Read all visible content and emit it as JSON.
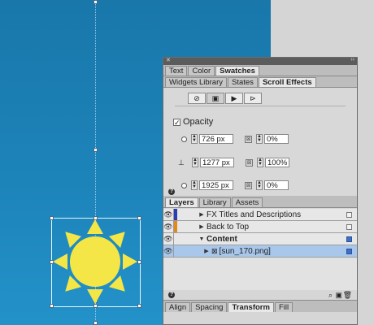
{
  "panel": {
    "top_tabs": [
      "Text",
      "Color",
      "Swatches"
    ],
    "active_top_tab": "Swatches",
    "second_tabs": [
      "Widgets Library",
      "States",
      "Scroll Effects"
    ],
    "active_second_tab": "Scroll Effects",
    "scroll_effects": {
      "mode_icons": [
        "link-icon",
        "image-icon",
        "play-icon",
        "slideshow-icon"
      ],
      "opacity_label": "Opacity",
      "opacity_checked": true,
      "rows": [
        {
          "position": "726 px",
          "opacity": "0%"
        },
        {
          "position": "1277 px",
          "opacity": "100%"
        },
        {
          "position": "1925 px",
          "opacity": "0%"
        }
      ]
    },
    "layer_tabs": [
      "Layers",
      "Library",
      "Assets"
    ],
    "active_layer_tab": "Layers",
    "layers": [
      {
        "name": "FX Titles and Descriptions",
        "color": "#2c3fb0",
        "bold": false,
        "selected": false,
        "vis_blue": false
      },
      {
        "name": "Back to Top",
        "color": "#e08a1e",
        "bold": false,
        "selected": false,
        "vis_blue": false
      },
      {
        "name": "Content",
        "color": "",
        "bold": true,
        "selected": false,
        "vis_blue": true
      },
      {
        "name": "[sun_170.png]",
        "color": "",
        "bold": false,
        "selected": true,
        "vis_blue": true
      }
    ],
    "bottom_tabs": [
      "Align",
      "Spacing",
      "Transform",
      "Fill"
    ],
    "active_bottom_tab": "Transform"
  },
  "colors": {
    "sun": "#f3e646",
    "canvas": "#1a7bb0",
    "selection_row": "#a8c7ea"
  }
}
